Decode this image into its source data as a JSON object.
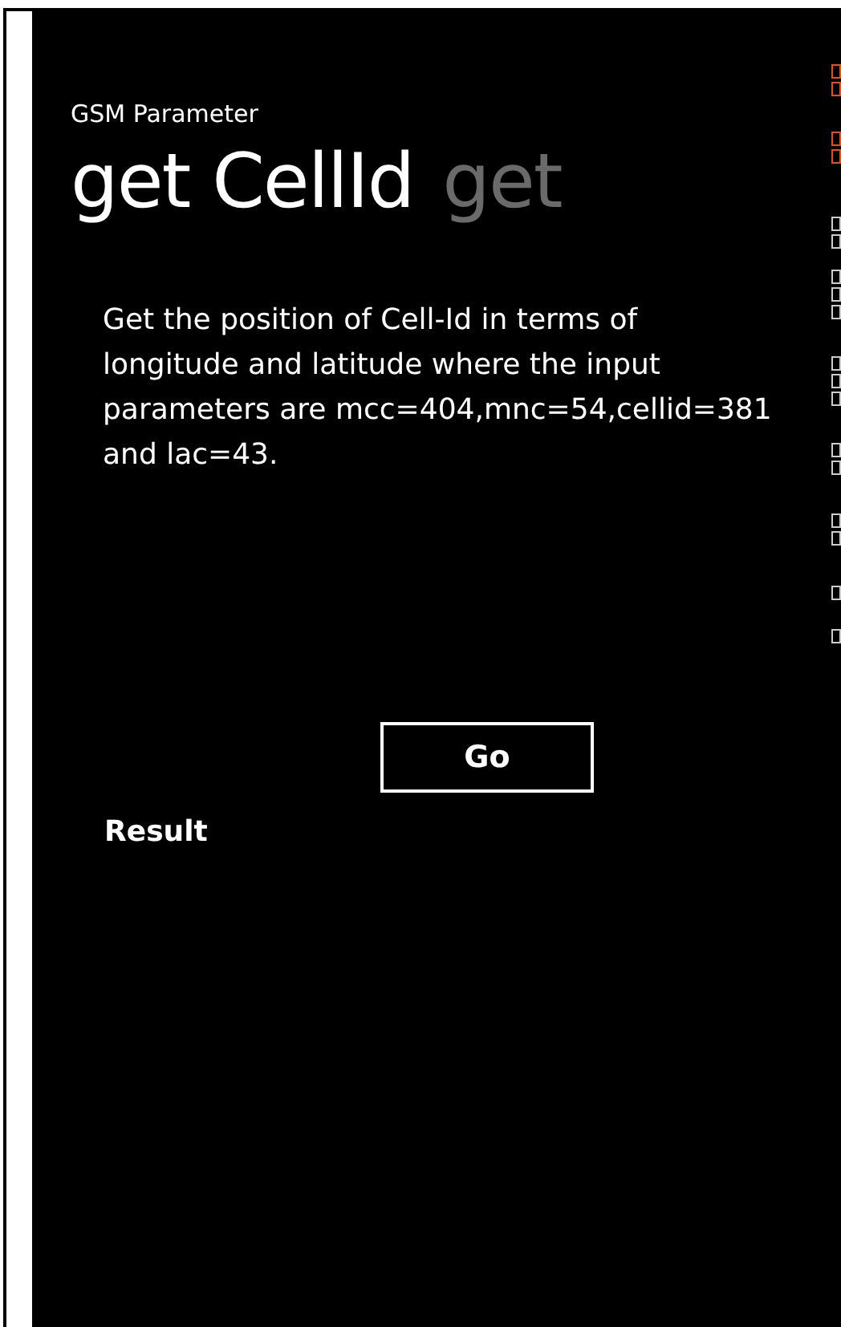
{
  "app_title": "GSM Parameter",
  "pivot_headers": [
    {
      "label": "get CellId",
      "selected": true
    },
    {
      "label": "get",
      "selected": false
    }
  ],
  "description": "Get the position of Cell-Id in terms of longitude and latitude where the input parameters are mcc=404,mnc=54,cellid=381 and lac=43.",
  "go_button": "Go",
  "result_label": "Result"
}
